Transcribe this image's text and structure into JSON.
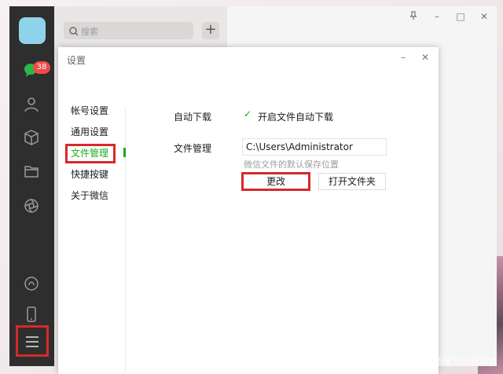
{
  "nav": {
    "badge_count": "38",
    "icons": [
      "chat-icon",
      "contacts-icon",
      "box-icon",
      "folder-icon",
      "moments-icon",
      "miniprogram-icon",
      "phone-icon",
      "menu-icon"
    ]
  },
  "chat_list": {
    "search_placeholder": "搜索",
    "add_label": "+"
  },
  "main": {
    "pin_icon": "pin-icon",
    "minimize": "–",
    "maximize": "□",
    "close": "✕"
  },
  "dialog": {
    "title": "设置",
    "minimize": "–",
    "close": "✕",
    "menu": [
      {
        "label": "帐号设置"
      },
      {
        "label": "通用设置"
      },
      {
        "label": "文件管理"
      },
      {
        "label": "快捷按键"
      },
      {
        "label": "关于微信"
      }
    ],
    "auto_download_label": "自动下载",
    "auto_download_option": "开启文件自动下载",
    "file_mgmt_label": "文件管理",
    "path_value": "C:\\Users\\Administrator",
    "path_hint": "微信文件的默认保存位置",
    "change_button": "更改",
    "open_folder_button": "打开文件夹"
  },
  "watermark": "百家号/U盘装机"
}
